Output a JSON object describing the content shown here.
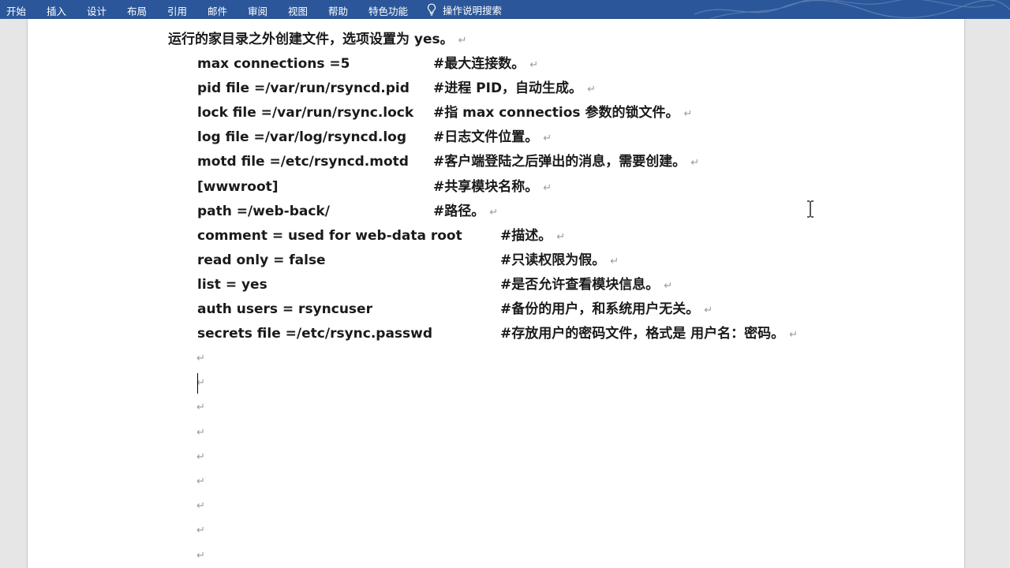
{
  "ribbon": {
    "tabs": [
      "开始",
      "插入",
      "设计",
      "布局",
      "引用",
      "邮件",
      "审阅",
      "视图",
      "帮助",
      "特色功能"
    ],
    "tell_me": "操作说明搜索",
    "bg_color": "#2b579a"
  },
  "document": {
    "intro_line": "运行的家目录之外创建文件，选项设置为 yes。",
    "paragraph_mark": "↵",
    "config_lines": [
      {
        "code": "max connections =5",
        "comment": "#最大连接数。"
      },
      {
        "code": "pid file =/var/run/rsyncd.pid",
        "comment": "#进程 PID，自动生成。"
      },
      {
        "code": "lock file =/var/run/rsync.lock",
        "comment": "#指 max connectios 参数的锁文件。"
      },
      {
        "code": "log file =/var/log/rsyncd.log",
        "comment": "#日志文件位置。"
      },
      {
        "code": "motd file =/etc/rsyncd.motd",
        "comment": "#客户端登陆之后弹出的消息，需要创建。"
      },
      {
        "code": "[wwwroot]",
        "comment": "#共享模块名称。"
      },
      {
        "code": "path =/web-back/",
        "comment": "#路径。"
      },
      {
        "code": "comment = used for web-data root",
        "comment": "#描述。"
      },
      {
        "code": "read only = false",
        "comment": "#只读权限为假。"
      },
      {
        "code": "list = yes",
        "comment": "#是否允许查看模块信息。"
      },
      {
        "code": "auth users = rsyncuser",
        "comment": "#备份的用户，和系统用户无关。"
      },
      {
        "code": "secrets file =/etc/rsync.passwd",
        "comment": "#存放用户的密码文件，格式是 用户名：密码。"
      }
    ],
    "empty_paragraph_count": 9
  }
}
